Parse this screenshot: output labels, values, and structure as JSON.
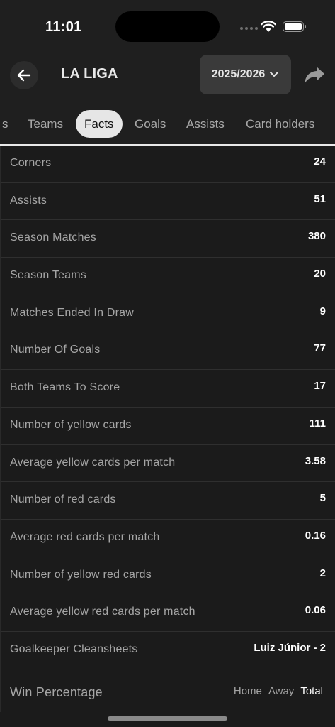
{
  "status_bar": {
    "time": "11:01"
  },
  "header": {
    "title": "LA LIGA",
    "season": "2025/2026"
  },
  "tabs": [
    {
      "label": "s",
      "active": false
    },
    {
      "label": "Teams",
      "active": false
    },
    {
      "label": "Facts",
      "active": true
    },
    {
      "label": "Goals",
      "active": false
    },
    {
      "label": "Assists",
      "active": false
    },
    {
      "label": "Card holders",
      "active": false
    }
  ],
  "facts": [
    {
      "label": "Corners",
      "value": "24"
    },
    {
      "label": "Assists",
      "value": "51"
    },
    {
      "label": "Season Matches",
      "value": "380"
    },
    {
      "label": "Season Teams",
      "value": "20"
    },
    {
      "label": "Matches Ended In Draw",
      "value": "9"
    },
    {
      "label": "Number Of Goals",
      "value": "77"
    },
    {
      "label": "Both Teams To Score",
      "value": "17"
    },
    {
      "label": "Number of yellow cards",
      "value": "111"
    },
    {
      "label": "Average yellow cards per match",
      "value": "3.58"
    },
    {
      "label": "Number of red cards",
      "value": "5"
    },
    {
      "label": "Average red cards per match",
      "value": "0.16"
    },
    {
      "label": "Number of yellow red cards",
      "value": "2"
    },
    {
      "label": "Average yellow red cards per match",
      "value": "0.06"
    },
    {
      "label": "Goalkeeper Cleansheets",
      "value": "Luiz Júnior - 2"
    }
  ],
  "win_percentage": {
    "label": "Win Percentage",
    "options": [
      "Home",
      "Away",
      "Total"
    ],
    "selected": "Total"
  }
}
